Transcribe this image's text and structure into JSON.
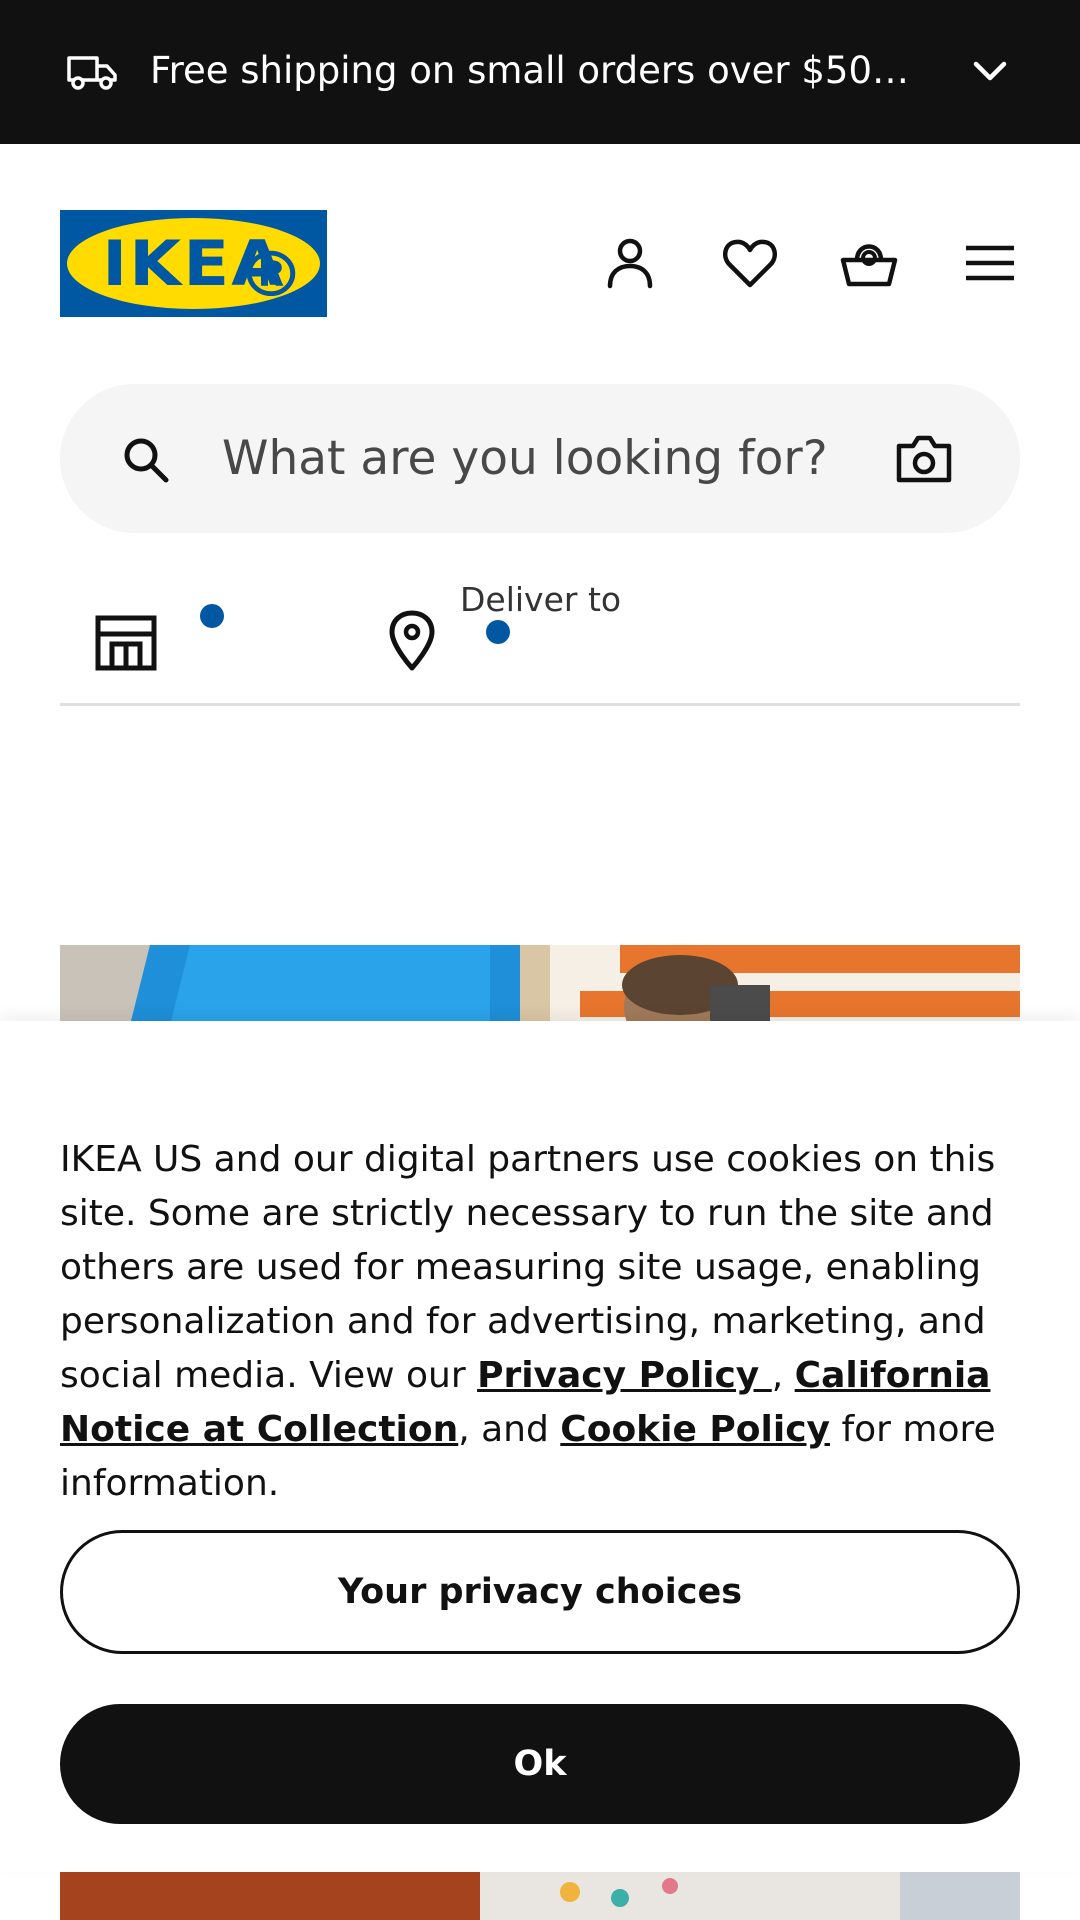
{
  "promo": {
    "text": "Free shipping on small orders over $50 fo...",
    "truck_icon": "truck-icon",
    "chevron_icon": "chevron-down-icon"
  },
  "header": {
    "logo_text": "IKEA",
    "logo_registered": "®",
    "colors": {
      "brand_blue": "#0058a3",
      "brand_yellow": "#ffdb00"
    },
    "icons": [
      "account-icon",
      "heart-icon",
      "basket-icon",
      "hamburger-menu-icon"
    ]
  },
  "search": {
    "placeholder": "What are you looking for?",
    "value": "",
    "search_icon": "search-icon",
    "camera_icon": "camera-icon"
  },
  "location": {
    "store_icon": "store-icon",
    "pin_icon": "location-pin-icon",
    "deliver_label": "Deliver to"
  },
  "cookie": {
    "msg_part1": "IKEA US and our digital partners use cookies on this site. Some are strictly necessary to run the site and others are used for measuring site usage, enabling personalization and for advertising, marketing, and social media. View our ",
    "privacy_link": "Privacy Policy ",
    "sep1": ", ",
    "california_link": "California Notice at Collection",
    "sep2": ", and ",
    "cookie_link": "Cookie Policy",
    "msg_end": " for more information.",
    "privacy_choices_label": "Your privacy choices",
    "ok_label": "Ok"
  }
}
